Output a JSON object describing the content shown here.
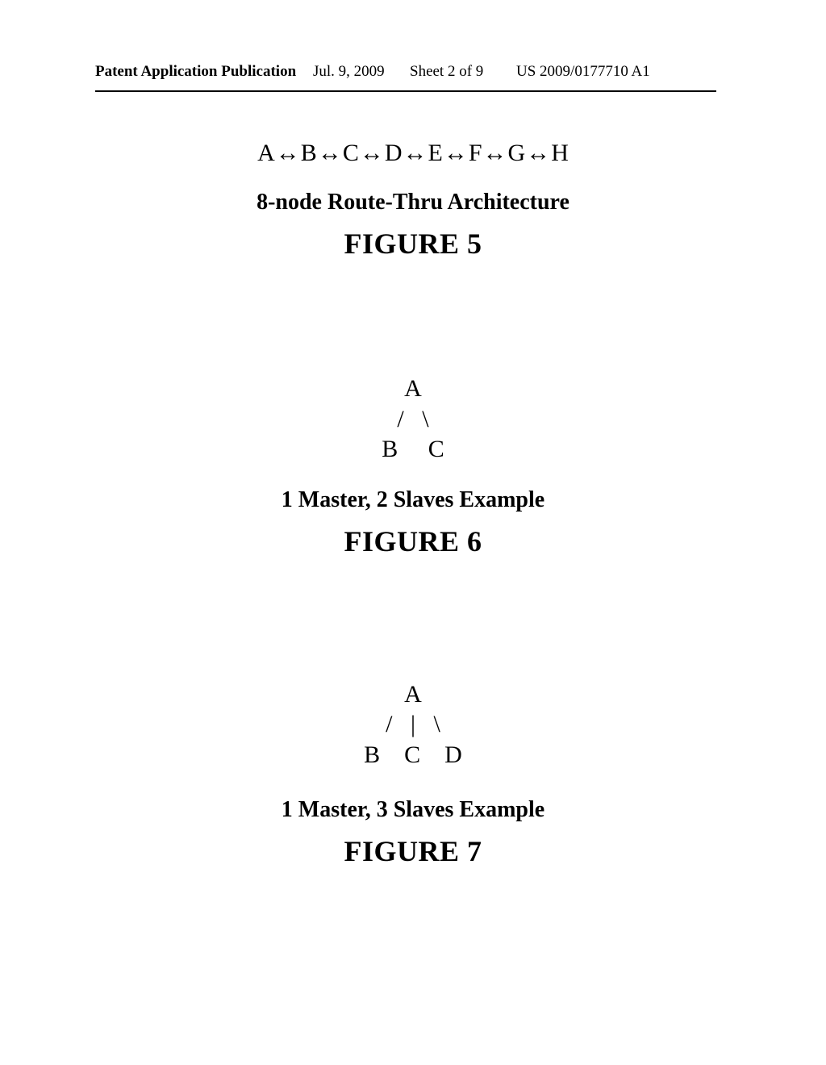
{
  "header": {
    "pub": "Patent Application Publication",
    "date": "Jul. 9, 2009",
    "sheet": "Sheet 2 of 9",
    "pubno": "US 2009/0177710 A1"
  },
  "fig5": {
    "nodes": [
      "A",
      "B",
      "C",
      "D",
      "E",
      "F",
      "G",
      "H"
    ],
    "arrow": "↔",
    "caption": "8-node Route-Thru Architecture",
    "label": "FIGURE 5"
  },
  "fig6": {
    "row1": "A",
    "row2": "/   \\",
    "row3": "B     C",
    "caption": "1 Master, 2 Slaves Example",
    "label": "FIGURE 6"
  },
  "fig7": {
    "row1": "A",
    "row2": "/   |   \\",
    "row3": "B    C    D",
    "caption": "1 Master, 3 Slaves Example",
    "label": "FIGURE 7"
  }
}
